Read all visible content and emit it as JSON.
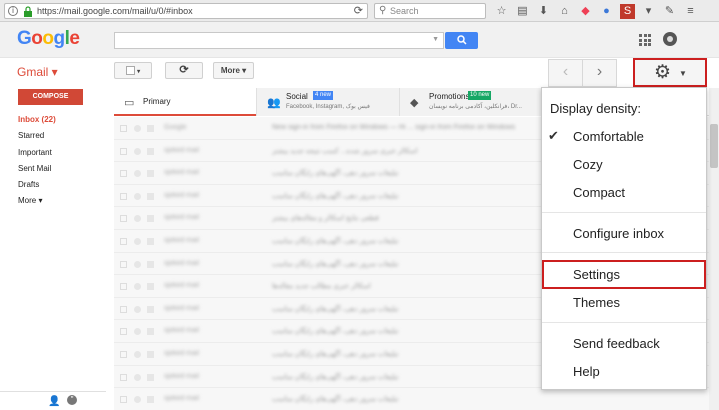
{
  "browser": {
    "url": "https://mail.google.com/mail/u/0/#inbox",
    "search_placeholder": "Search",
    "toolbar_icons": [
      "star-icon",
      "reading-list-icon",
      "download-icon",
      "home-icon",
      "pocket-icon",
      "sync-icon",
      "addon-icon",
      "bookmark-icon",
      "pen-icon",
      "menu-icon"
    ]
  },
  "header": {
    "logo": "Google",
    "search_button": "🔍"
  },
  "actions": {
    "gmail_label": "Gmail ▾",
    "refresh": "⟳",
    "more_label": "More ▾",
    "prev": "‹",
    "next": "›"
  },
  "leftnav": {
    "compose": "COMPOSE",
    "items": [
      {
        "label": "Inbox (22)",
        "active": true
      },
      {
        "label": "Starred"
      },
      {
        "label": "Important"
      },
      {
        "label": "Sent Mail"
      },
      {
        "label": "Drafts"
      },
      {
        "label": "More ▾"
      }
    ]
  },
  "tabs": {
    "primary": "Primary",
    "social": {
      "label": "Social",
      "badge": "4 new",
      "sub": "Facebook, Instagram, فیس بوک"
    },
    "promos": {
      "label": "Promotions",
      "badge": "10 new",
      "sub": "فرانکلین، آکادمی برنامه نویسان، Dr..."
    }
  },
  "emails": [
    {
      "sender": "Google",
      "subject": "New sign-in from Firefox on Windows — Hi ... sign-in from Firefox on Windows"
    },
    {
      "sender": "spiked mail",
      "subject": "اسکالر خبری سرور شده... کسب نتیجه جدید بیشتر"
    },
    {
      "sender": "spiked mail",
      "subject": "تبلیغات سرور دهی، آگهی‌های رایگان مناسب"
    },
    {
      "sender": "spiked mail",
      "subject": "تبلیغات سرور دهی، آگهی‌های رایگان مناسب"
    },
    {
      "sender": "spiked mail",
      "subject": "قطعی نتایج اسکالر و مقاله‌های بیشتر"
    },
    {
      "sender": "spiked mail",
      "subject": "تبلیغات سرور دهی، آگهی‌های رایگان مناسب"
    },
    {
      "sender": "spiked mail",
      "subject": "تبلیغات سرور دهی، آگهی‌های رایگان مناسب"
    },
    {
      "sender": "spiked mail",
      "subject": "اسکالر خبری مطالب جدید مقاله‌ها"
    },
    {
      "sender": "spiked mail",
      "subject": "تبلیغات سرور دهی، آگهی‌های رایگان مناسب"
    },
    {
      "sender": "spiked mail",
      "subject": "تبلیغات سرور دهی، آگهی‌های رایگان مناسب"
    },
    {
      "sender": "spiked mail",
      "subject": "تبلیغات سرور دهی، آگهی‌های رایگان مناسب"
    },
    {
      "sender": "spiked mail",
      "subject": "تبلیغات سرور دهی، آگهی‌های رایگان مناسب"
    },
    {
      "sender": "spiked mail",
      "subject": "تبلیغات سرور دهی، آگهی‌های رایگان مناسب"
    }
  ],
  "menu": {
    "heading": "Display density:",
    "check": "✔",
    "comfortable": "Comfortable",
    "cozy": "Cozy",
    "compact": "Compact",
    "configure": "Configure inbox",
    "settings": "Settings",
    "themes": "Themes",
    "feedback": "Send feedback",
    "help": "Help"
  },
  "colors": {
    "accent_red": "#dd4b39",
    "highlight_box": "#cc1f1f",
    "search_blue": "#4285f4"
  }
}
